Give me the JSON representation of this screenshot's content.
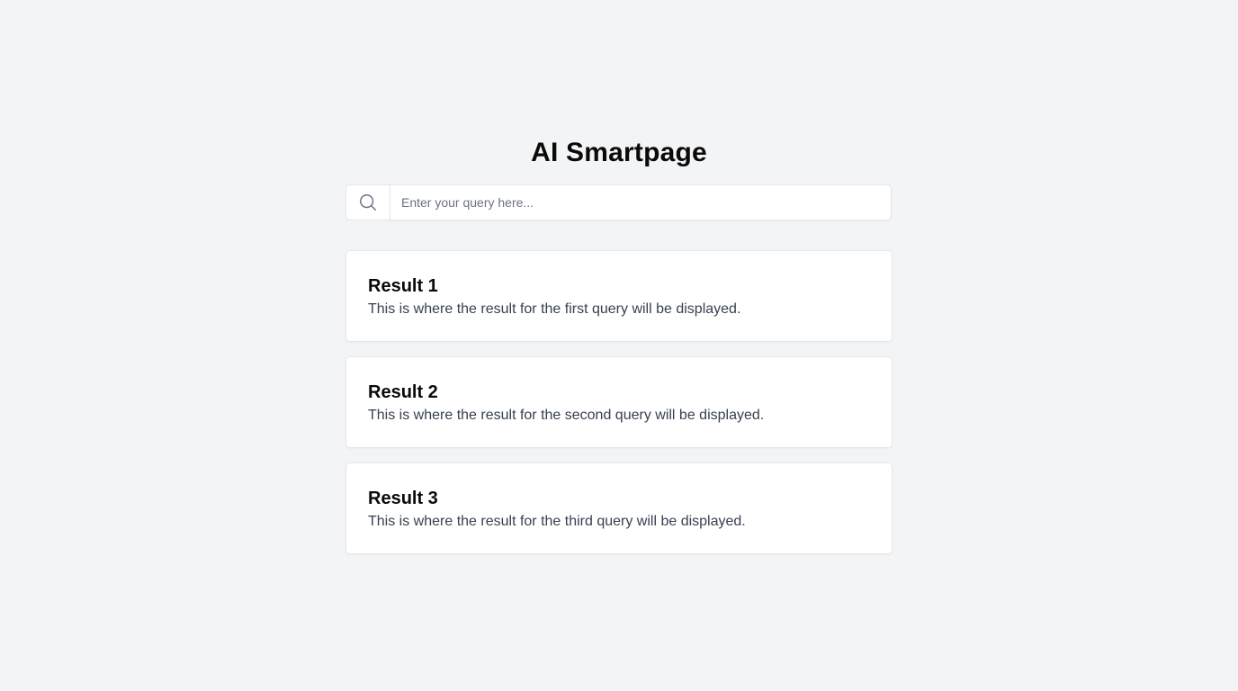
{
  "header": {
    "title": "AI Smartpage"
  },
  "search": {
    "icon": "search-icon",
    "placeholder": "Enter your query here...",
    "value": ""
  },
  "results": [
    {
      "title": "Result 1",
      "text": "This is where the result for the first query will be displayed."
    },
    {
      "title": "Result 2",
      "text": "This is where the result for the second query will be displayed."
    },
    {
      "title": "Result 3",
      "text": "This is where the result for the third query will be displayed."
    }
  ],
  "colors": {
    "background": "#f3f4f6",
    "card": "#ffffff",
    "border": "#e5e7eb",
    "body_text": "#374151",
    "heading": "#0a0a0a"
  }
}
